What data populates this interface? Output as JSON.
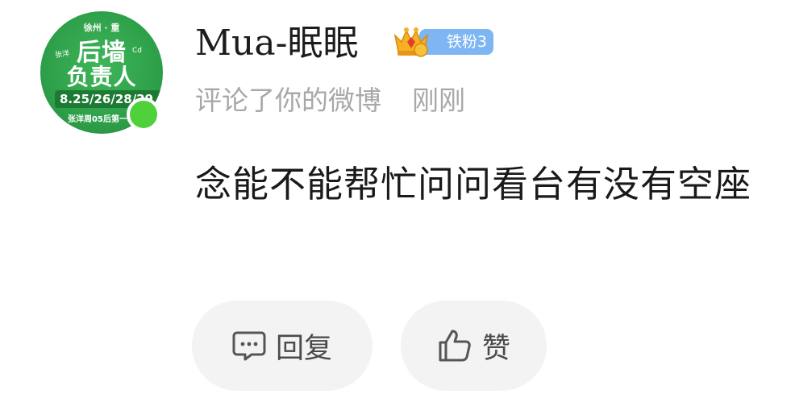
{
  "avatar": {
    "top_text": "徐州 · 重",
    "main_line1": "后墙",
    "main_line2": "负责人",
    "side_text": "张洋",
    "small_text": "Cd",
    "dates": "8.25/26/28/29",
    "bottom_text": "张洋周05后第一场",
    "online_color": "#4fd13c"
  },
  "user": {
    "name": "Mua-眠眠",
    "badge_label": "铁粉3",
    "badge_color": "#7eb6f3"
  },
  "notification": {
    "action": "评论了你的微博",
    "time": "刚刚",
    "content": "念能不能帮忙问问看台有没有空座"
  },
  "actions": {
    "reply_label": "回复",
    "reply_icon": "comment-icon",
    "like_label": "赞",
    "like_icon": "thumbs-up-icon"
  }
}
